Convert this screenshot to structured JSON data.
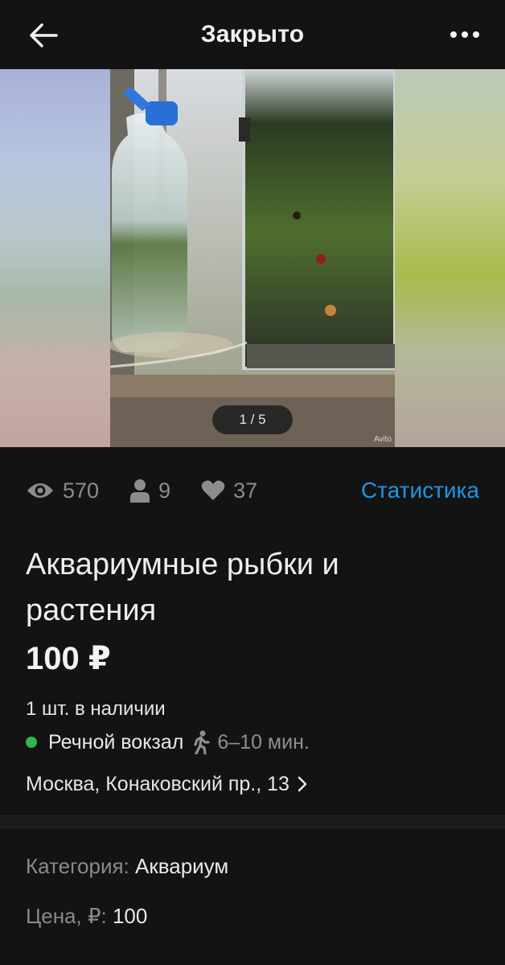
{
  "header": {
    "title": "Закрыто"
  },
  "gallery": {
    "counter": "1 / 5",
    "watermark": "Avito"
  },
  "stats": {
    "views": "570",
    "contacts": "9",
    "favorites": "37",
    "link_label": "Статистика"
  },
  "listing": {
    "title": "Аквариумные рыбки и растения",
    "price": "100 ₽",
    "availability": "1 шт. в наличии",
    "metro": {
      "station": "Речной вокзал",
      "walk_time": "6–10 мин.",
      "line_color": "#30b748"
    },
    "address": "Москва, Конаковский пр., 13"
  },
  "params": [
    {
      "label": "Категория: ",
      "value": "Аквариум"
    },
    {
      "label": "Цена, ₽: ",
      "value": "100"
    }
  ],
  "colors": {
    "accent_link": "#1e96e6",
    "background": "#131313"
  }
}
